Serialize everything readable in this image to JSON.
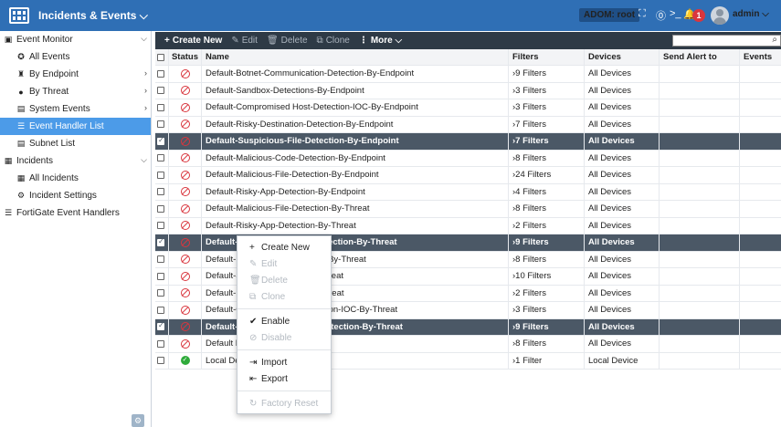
{
  "header": {
    "title": "Incidents & Events ⌵",
    "adom": "ADOM: root",
    "notification_count": "1",
    "user": "admin ⌵"
  },
  "sidebar": {
    "items": [
      {
        "label": "Event Monitor",
        "icon": "event-monitor-icon",
        "glyph": "▣",
        "level": 0,
        "chevron": "⌵"
      },
      {
        "label": "All Events",
        "icon": "all-events-icon",
        "glyph": "✪",
        "level": 1
      },
      {
        "label": "By Endpoint",
        "icon": "endpoint-icon",
        "glyph": "♜",
        "level": 1,
        "chevron": "›"
      },
      {
        "label": "By Threat",
        "icon": "threat-icon",
        "glyph": "●",
        "level": 1,
        "chevron": "›"
      },
      {
        "label": "System Events",
        "icon": "system-events-icon",
        "glyph": "▤",
        "level": 1,
        "chevron": "›"
      },
      {
        "label": "Event Handler List",
        "icon": "event-handler-list-icon",
        "glyph": "☰",
        "level": 1,
        "active": true
      },
      {
        "label": "Subnet List",
        "icon": "subnet-list-icon",
        "glyph": "▤",
        "level": 1
      },
      {
        "label": "Incidents",
        "icon": "incidents-icon",
        "glyph": "▦",
        "level": 0,
        "chevron": "⌵"
      },
      {
        "label": "All Incidents",
        "icon": "all-incidents-icon",
        "glyph": "▦",
        "level": 1
      },
      {
        "label": "Incident Settings",
        "icon": "incident-settings-icon",
        "glyph": "⚙",
        "level": 1
      },
      {
        "label": "FortiGate Event Handlers",
        "icon": "fortigate-icon",
        "glyph": "☰",
        "level": 0
      }
    ]
  },
  "toolbar": {
    "create_new": "Create New",
    "edit": "Edit",
    "delete": "Delete",
    "clone": "Clone",
    "more": "More ⌵"
  },
  "search": {
    "placeholder": ""
  },
  "table": {
    "columns": [
      "Status",
      "Name",
      "Filters",
      "Devices",
      "Send Alert to",
      "Events"
    ],
    "rows": [
      {
        "status": "disabled",
        "name": "Default-Botnet-Communication-Detection-By-Endpoint",
        "filters": "9 Filters",
        "devices": "All Devices",
        "selected": false
      },
      {
        "status": "disabled",
        "name": "Default-Sandbox-Detections-By-Endpoint",
        "filters": "3 Filters",
        "devices": "All Devices",
        "selected": false
      },
      {
        "status": "disabled",
        "name": "Default-Compromised Host-Detection-IOC-By-Endpoint",
        "filters": "3 Filters",
        "devices": "All Devices",
        "selected": false
      },
      {
        "status": "disabled",
        "name": "Default-Risky-Destination-Detection-By-Endpoint",
        "filters": "7 Filters",
        "devices": "All Devices",
        "selected": false
      },
      {
        "status": "disabled",
        "name": "Default-Suspicious-File-Detection-By-Endpoint",
        "filters": "7 Filters",
        "devices": "All Devices",
        "selected": true
      },
      {
        "status": "disabled",
        "name": "Default-Malicious-Code-Detection-By-Endpoint",
        "filters": "8 Filters",
        "devices": "All Devices",
        "selected": false
      },
      {
        "status": "disabled",
        "name": "Default-Malicious-File-Detection-By-Endpoint",
        "filters": "24 Filters",
        "devices": "All Devices",
        "selected": false
      },
      {
        "status": "disabled",
        "name": "Default-Risky-App-Detection-By-Endpoint",
        "filters": "4 Filters",
        "devices": "All Devices",
        "selected": false
      },
      {
        "status": "disabled",
        "name": "Default-Malicious-File-Detection-By-Threat",
        "filters": "8 Filters",
        "devices": "All Devices",
        "selected": false
      },
      {
        "status": "disabled",
        "name": "Default-Risky-App-Detection-By-Threat",
        "filters": "2 Filters",
        "devices": "All Devices",
        "selected": false
      },
      {
        "status": "disabled",
        "name": "Default-Risky-Destination-Detection-By-Threat",
        "filters": "9 Filters",
        "devices": "All Devices",
        "selected": true
      },
      {
        "status": "disabled",
        "name": "Default-M                                  -By-Threat",
        "filters": "8 Filters",
        "devices": "All Devices",
        "selected": false
      },
      {
        "status": "disabled",
        "name": "Default-S                                  hreat",
        "filters": "10 Filters",
        "devices": "All Devices",
        "selected": false
      },
      {
        "status": "disabled",
        "name": "Default-D                                  hreat",
        "filters": "2 Filters",
        "devices": "All Devices",
        "selected": false
      },
      {
        "status": "disabled",
        "name": "Default-C                                  tion-IOC-By-Threat",
        "filters": "3 Filters",
        "devices": "All Devices",
        "selected": false
      },
      {
        "status": "disabled",
        "name": "Default-B                                  etection-By-Threat",
        "filters": "9 Filters",
        "devices": "All Devices",
        "selected": true
      },
      {
        "status": "disabled",
        "name": "Default F",
        "filters": "8 Filters",
        "devices": "All Devices",
        "selected": false
      },
      {
        "status": "enabled",
        "name": "Local Dev",
        "filters": "1 Filter",
        "devices": "Local Device",
        "selected": false
      }
    ]
  },
  "context_menu": {
    "items": [
      {
        "label": "Create New",
        "icon": "plus-icon",
        "glyph": "+",
        "enabled": true
      },
      {
        "label": "Edit",
        "icon": "edit-icon",
        "glyph": "✎",
        "enabled": false
      },
      {
        "label": "Delete",
        "icon": "trash-icon",
        "glyph": "🗑",
        "enabled": false
      },
      {
        "label": "Clone",
        "icon": "clone-icon",
        "glyph": "⧉",
        "enabled": false
      },
      {
        "separator": true
      },
      {
        "label": "Enable",
        "icon": "enable-icon",
        "glyph": "✔",
        "enabled": true
      },
      {
        "label": "Disable",
        "icon": "disable-icon",
        "glyph": "⊘",
        "enabled": false
      },
      {
        "separator": true
      },
      {
        "label": "Import",
        "icon": "import-icon",
        "glyph": "⇥",
        "enabled": true
      },
      {
        "label": "Export",
        "icon": "export-icon",
        "glyph": "⇤",
        "enabled": true
      },
      {
        "separator": true
      },
      {
        "label": "Factory Reset",
        "icon": "factory-reset-icon",
        "glyph": "↻",
        "enabled": false
      }
    ]
  },
  "colors": {
    "topbar": "#2f6fb5",
    "toolbar": "#2e3a46",
    "selected_row": "#4b5866",
    "active_nav": "#4c9be8",
    "disabled_status": "#d9363e",
    "enabled_status": "#2fab3b"
  }
}
